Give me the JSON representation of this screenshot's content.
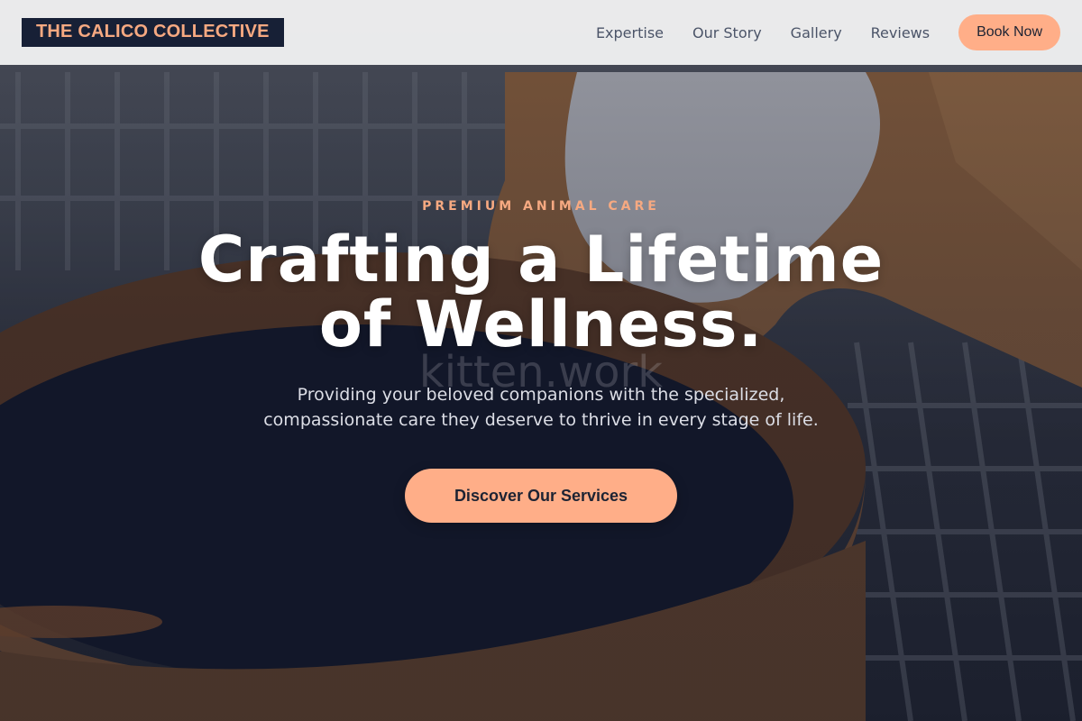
{
  "brand": {
    "logo_text": "THE CALICO COLLECTIVE"
  },
  "nav": {
    "items": [
      {
        "label": "Expertise"
      },
      {
        "label": "Our Story"
      },
      {
        "label": "Gallery"
      },
      {
        "label": "Reviews"
      }
    ],
    "cta_label": "Book Now"
  },
  "hero": {
    "eyebrow": "PREMIUM ANIMAL CARE",
    "headline_line1": "Crafting a Lifetime",
    "headline_line2": "of Wellness.",
    "watermark": "kitten.work",
    "subtext_line1": "Providing your beloved companions with the specialized,",
    "subtext_line2": "compassionate care they deserve to thrive in every stage of life.",
    "cta_label": "Discover Our Services",
    "background_image": "guinea pig drinking from a ceramic bowl on a wire grate"
  },
  "colors": {
    "accent": "#ffae88",
    "accent_text": "#f6a981",
    "navy": "#172036",
    "header_bg": "#f0f0f1"
  }
}
